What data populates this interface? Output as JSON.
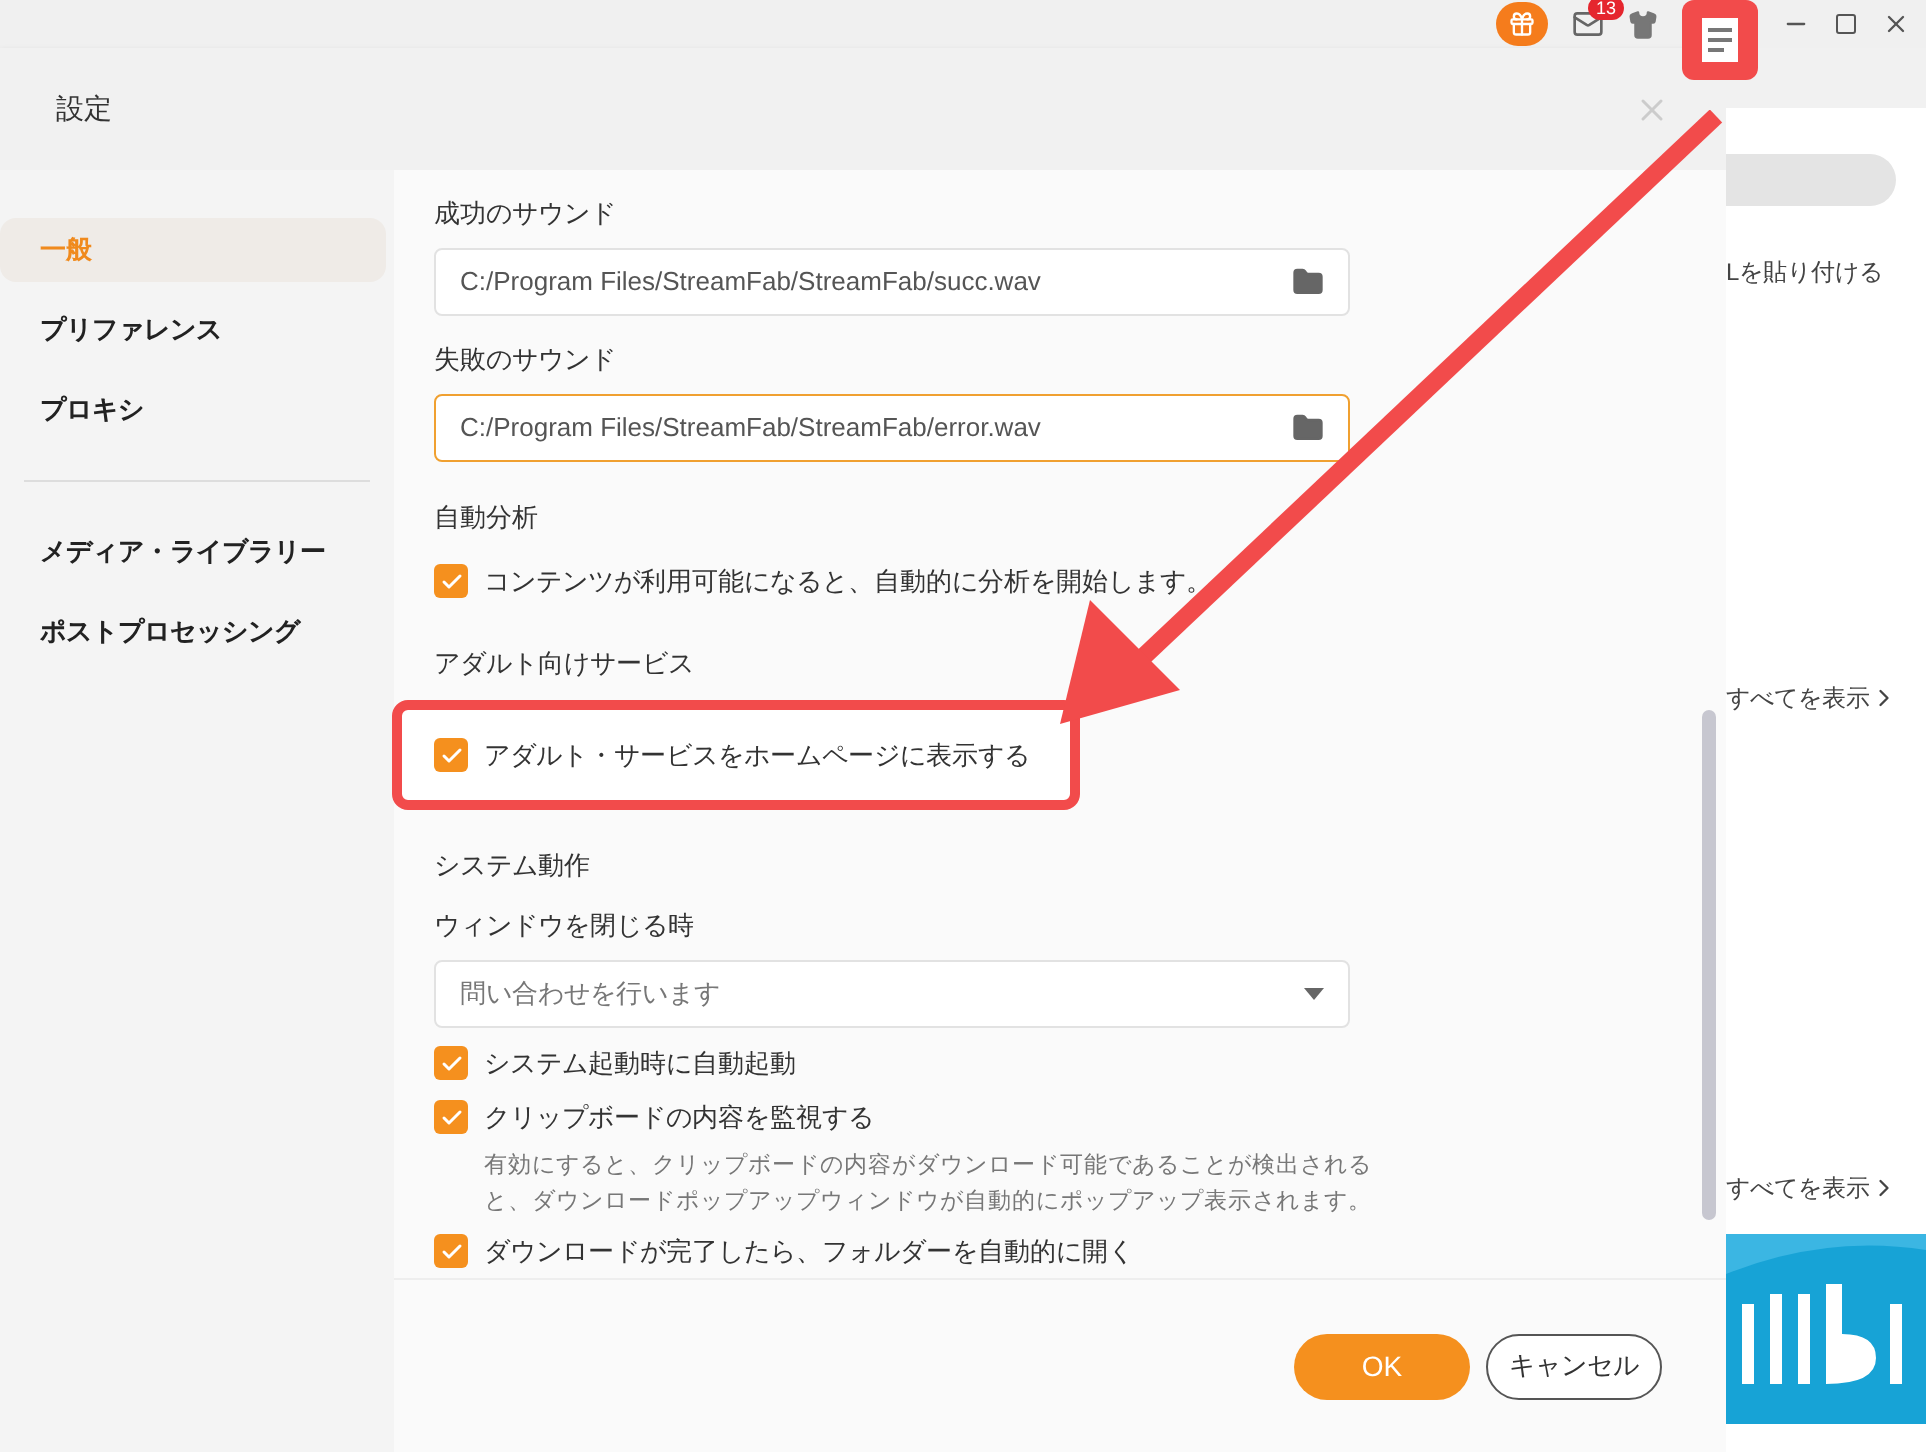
{
  "topbar": {
    "mail_badge": "13"
  },
  "dialog": {
    "title": "設定",
    "sidebar": {
      "items": [
        {
          "label": "一般",
          "selected": true
        },
        {
          "label": "プリファレンス",
          "selected": false
        },
        {
          "label": "プロキシ",
          "selected": false
        }
      ],
      "items_2": [
        {
          "label": "メディア・ライブラリー",
          "selected": false
        },
        {
          "label": "ポストプロセッシング",
          "selected": false
        }
      ]
    },
    "content": [
      {
        "kind": "label",
        "text": "成功のサウンド"
      },
      {
        "kind": "path",
        "value": "C:/Program Files/StreamFab/StreamFab/succ.wav",
        "focused": false
      },
      {
        "kind": "label",
        "text": "失敗のサウンド"
      },
      {
        "kind": "path",
        "value": "C:/Program Files/StreamFab/StreamFab/error.wav",
        "focused": true
      },
      {
        "kind": "heading",
        "text": "自動分析"
      },
      {
        "kind": "checkbox",
        "label": "コンテンツが利用可能になると、自動的に分析を開始します。",
        "checked": true,
        "highlighted": false
      },
      {
        "kind": "heading",
        "text": "アダルト向けサービス"
      },
      {
        "kind": "checkbox",
        "label": "アダルト・サービスをホームページに表示する",
        "checked": true,
        "highlighted": true
      },
      {
        "kind": "heading",
        "text": "システム動作"
      },
      {
        "kind": "label",
        "text": "ウィンドウを閉じる時"
      },
      {
        "kind": "select",
        "value": "問い合わせを行います"
      },
      {
        "kind": "checkbox",
        "label": "システム起動時に自動起動",
        "checked": true,
        "highlighted": false
      },
      {
        "kind": "checkbox",
        "label": "クリップボードの内容を監視する",
        "checked": true,
        "highlighted": false
      },
      {
        "kind": "note",
        "text": "有効にすると、クリップボードの内容がダウンロード可能であることが検出されると、ダウンロードポップアップウィンドウが自動的にポップアップ表示されます。"
      },
      {
        "kind": "checkbox",
        "label": "ダウンロードが完了したら、フォルダーを自動的に開く",
        "checked": true,
        "highlighted": false
      }
    ],
    "buttons": {
      "ok": "OK",
      "cancel": "キャンセル"
    }
  },
  "background": {
    "paste_hint": "Lを貼り付ける",
    "view_all": [
      "すべてを表示",
      "すべてを表示"
    ]
  }
}
